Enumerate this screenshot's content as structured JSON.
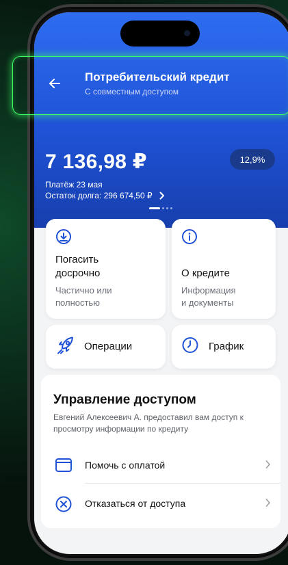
{
  "header": {
    "title": "Потребительский кредит",
    "subtitle": "С совместным доступом"
  },
  "summary": {
    "amount": "7 136,98 ₽",
    "rate": "12,9%",
    "payment_date": "Платёж 23 мая",
    "debt": "Остаток долга: 296 674,50 ₽"
  },
  "actions": [
    {
      "title_line1": "Погасить",
      "title_line2": "досрочно",
      "desc_line1": "Частично или",
      "desc_line2": "полностью",
      "icon": "download-circle-icon"
    },
    {
      "title": "О кредите",
      "desc_line1": "Информация",
      "desc_line2": "и документы",
      "icon": "info-circle-icon"
    }
  ],
  "quick": [
    {
      "title": "Операции",
      "icon": "rocket-icon"
    },
    {
      "title": "График",
      "icon": "clock-icon"
    }
  ],
  "access": {
    "title": "Управление доступом",
    "description": "Евгений Алексеевич А. предоставил вам доступ к просмотру информации по кредиту",
    "items": [
      {
        "label": "Помочь с оплатой",
        "icon": "wallet-icon"
      },
      {
        "label": "Отказаться от доступа",
        "icon": "close-circle-icon"
      }
    ]
  },
  "colors": {
    "primary_blue": "#2e6df0",
    "highlight": "#3dff66",
    "icon_blue": "#1f52d6"
  }
}
